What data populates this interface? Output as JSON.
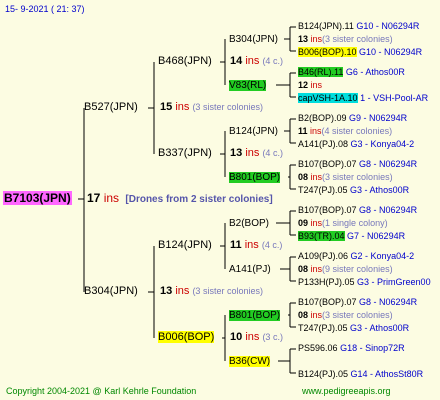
{
  "header": {
    "date": "15-  9-2021  (  21:  37)"
  },
  "footer": {
    "copyright": "Copyright 2004-2021 @ Karl Kehrle Foundation",
    "site": "www.pedigreeapis.org"
  },
  "root": {
    "name": "B7103(JPN)",
    "ins": "17",
    "ins_word": "ins",
    "note": "[Drones from 2 sister colonies]"
  },
  "gen2": [
    {
      "name": "B527(JPN)",
      "ins": "15",
      "ins_word": "ins",
      "note": "(3 sister colonies)"
    },
    {
      "name": "B304(JPN)",
      "ins": "13",
      "ins_word": "ins",
      "note": "(3 sister colonies)"
    }
  ],
  "gen3": [
    {
      "name": "B468(JPN)",
      "ins": "14",
      "ins_word": "ins",
      "note": "(4 c.)"
    },
    {
      "name": "B337(JPN)",
      "ins": "13",
      "ins_word": "ins",
      "note": "(4 c.)"
    },
    {
      "name": "B124(JPN)",
      "ins": "11",
      "ins_word": "ins",
      "note": "(4 c.)"
    },
    {
      "name": "B006(BOP)",
      "ins": "10",
      "ins_word": "ins",
      "note": "(3 c.)"
    }
  ],
  "gen4": [
    {
      "name": "B304(JPN)",
      "ins": "13",
      "ins_word": "ins",
      "note": "(3 sister colonies)"
    },
    {
      "name": "V83(RL)",
      "ins": "12",
      "ins_word": "ins",
      "note": ""
    },
    {
      "name": "B124(JPN)",
      "ins": "11",
      "ins_word": "ins",
      "note": "(4 sister colonies)"
    },
    {
      "name": "B801(BOP)",
      "ins": "08",
      "ins_word": "ins",
      "note": "(3 sister colonies)"
    },
    {
      "name": "B2(BOP)",
      "ins": "09",
      "ins_word": "ins",
      "note": "(1 single colony)"
    },
    {
      "name": "A141(PJ)",
      "ins": "08",
      "ins_word": "ins",
      "note": "(9 sister colonies)"
    },
    {
      "name": "B801(BOP)",
      "ins": "08",
      "ins_word": "ins",
      "note": "(3 sister colonies)"
    },
    {
      "name": "B36(CW)",
      "ins": "",
      "ins_word": "",
      "note": ""
    }
  ],
  "gen5": [
    {
      "name": "B124(JPN).11",
      "iid": "G10 - N06294R"
    },
    {
      "name": "B006(BOP).10",
      "iid": "G10 - N06294R"
    },
    {
      "name": "B46(RL).11",
      "iid": "G6 - Athos00R"
    },
    {
      "name": "capVSH-1A.10",
      "iid": "1 - VSH-Pool-AR"
    },
    {
      "name": "B2(BOP).09",
      "iid": "G9 - N06294R"
    },
    {
      "name": "A141(PJ).08",
      "iid": "G3 - Konya04-2"
    },
    {
      "name": "B107(BOP).07",
      "iid": "G8 - N06294R"
    },
    {
      "name": "T247(PJ).05",
      "iid": "G3 - Athos00R"
    },
    {
      "name": "B107(BOP).07",
      "iid": "G8 - N06294R"
    },
    {
      "name": "B93(TR).04",
      "iid": "G7 - N06294R"
    },
    {
      "name": "A109(PJ).06",
      "iid": "G2 - Konya04-2"
    },
    {
      "name": "P133H(PJ).05",
      "iid": "G3 - PrimGreen00"
    },
    {
      "name": "B107(BOP).07",
      "iid": "G8 - N06294R"
    },
    {
      "name": "T247(PJ).05",
      "iid": "G3 - Athos00R"
    },
    {
      "name": "PS596.06",
      "iid": "G18 - Sinop72R"
    },
    {
      "name": "B124(PJ).05",
      "iid": "G14 - AthosSt80R"
    }
  ]
}
